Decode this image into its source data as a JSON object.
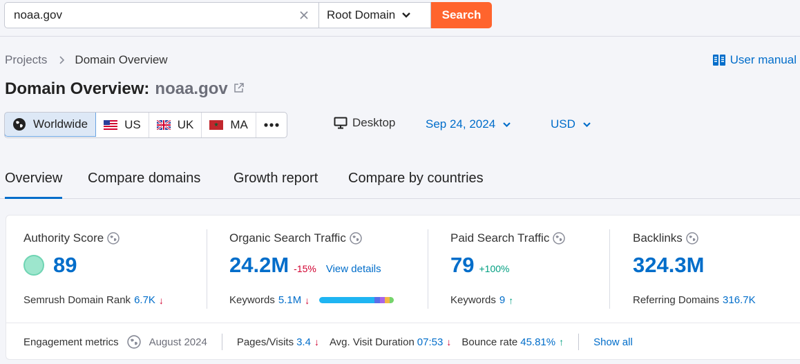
{
  "search": {
    "query": "noaa.gov",
    "scope": "Root Domain",
    "button_label": "Search"
  },
  "breadcrumb": {
    "parent": "Projects",
    "current": "Domain Overview"
  },
  "user_manual_label": "User manual",
  "title": {
    "prefix": "Domain Overview:",
    "domain": "noaa.gov"
  },
  "regions": [
    {
      "label": "Worldwide",
      "icon": "globe-icon"
    },
    {
      "label": "US",
      "icon": "us-flag-icon"
    },
    {
      "label": "UK",
      "icon": "uk-flag-icon"
    },
    {
      "label": "MA",
      "icon": "morocco-flag-icon"
    }
  ],
  "device_label": "Desktop",
  "date_label": "Sep 24, 2024",
  "currency_label": "USD",
  "tabs": [
    {
      "label": "Overview",
      "active": true
    },
    {
      "label": "Compare domains",
      "active": false
    },
    {
      "label": "Growth report",
      "active": false
    },
    {
      "label": "Compare by countries",
      "active": false
    }
  ],
  "metrics": {
    "authority": {
      "label": "Authority Score",
      "value": "89",
      "sub_label": "Semrush Domain Rank",
      "sub_value": "6.7K",
      "sub_trend": "↓"
    },
    "organic": {
      "label": "Organic Search Traffic",
      "value": "24.2M",
      "delta": "-15%",
      "link": "View details",
      "sub_label": "Keywords",
      "sub_value": "5.1M",
      "sub_trend": "↓",
      "keyword_bar": [
        {
          "color": "#1fb5f2",
          "share": 0.74
        },
        {
          "color": "#5c6ee8",
          "share": 0.07
        },
        {
          "color": "#a864e8",
          "share": 0.07
        },
        {
          "color": "#f3b843",
          "share": 0.06
        },
        {
          "color": "#76d36b",
          "share": 0.06
        }
      ]
    },
    "paid": {
      "label": "Paid Search Traffic",
      "value": "79",
      "delta": "+100%",
      "sub_label": "Keywords",
      "sub_value": "9",
      "sub_trend": "↑"
    },
    "backlinks": {
      "label": "Backlinks",
      "value": "324.3M",
      "sub_label": "Referring Domains",
      "sub_value": "316.7K"
    }
  },
  "engagement": {
    "label": "Engagement metrics",
    "period": "August 2024",
    "pages_label": "Pages/Visits",
    "pages_value": "3.4",
    "pages_trend": "↓",
    "duration_label": "Avg. Visit Duration",
    "duration_value": "07:53",
    "duration_trend": "↓",
    "bounce_label": "Bounce rate",
    "bounce_value": "45.81%",
    "bounce_trend": "↑",
    "show_all": "Show all"
  },
  "colors": {
    "accent_blue": "#006dca",
    "search_orange": "#ff642d",
    "negative": "#d1002f",
    "positive": "#009f81"
  }
}
